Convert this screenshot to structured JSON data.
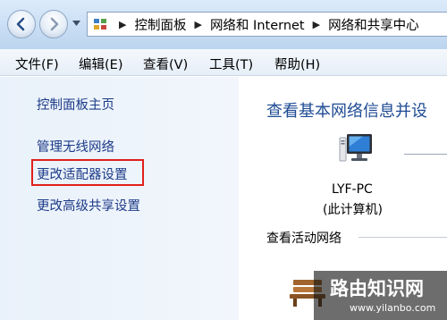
{
  "address_bar": {
    "crumbs": [
      "控制面板",
      "网络和 Internet",
      "网络和共享中心"
    ]
  },
  "menu": {
    "items": [
      "文件(F)",
      "编辑(E)",
      "查看(V)",
      "工具(T)",
      "帮助(H)"
    ]
  },
  "left_pane": {
    "links": [
      "控制面板主页",
      "管理无线网络",
      "更改适配器设置",
      "更改高级共享设置"
    ],
    "highlighted_index": 2,
    "highlight_color": "#e0201c"
  },
  "main": {
    "title": "查看基本网络信息并设",
    "computer": {
      "name": "LYF-PC",
      "subtitle": "(此计算机)"
    },
    "active_networks_label": "查看活动网络"
  },
  "watermark": {
    "title": "路由知识网",
    "url": "www.yilanbo.com"
  },
  "colors": {
    "link": "#1c3a87",
    "title": "#1e4b94",
    "left_pane_bg": "#e9f1fa"
  },
  "icons": {
    "back": "back-arrow-icon",
    "forward": "forward-arrow-icon",
    "address": "control-panel-icon",
    "computer": "computer-monitor-icon",
    "network": "bench-network-icon"
  }
}
